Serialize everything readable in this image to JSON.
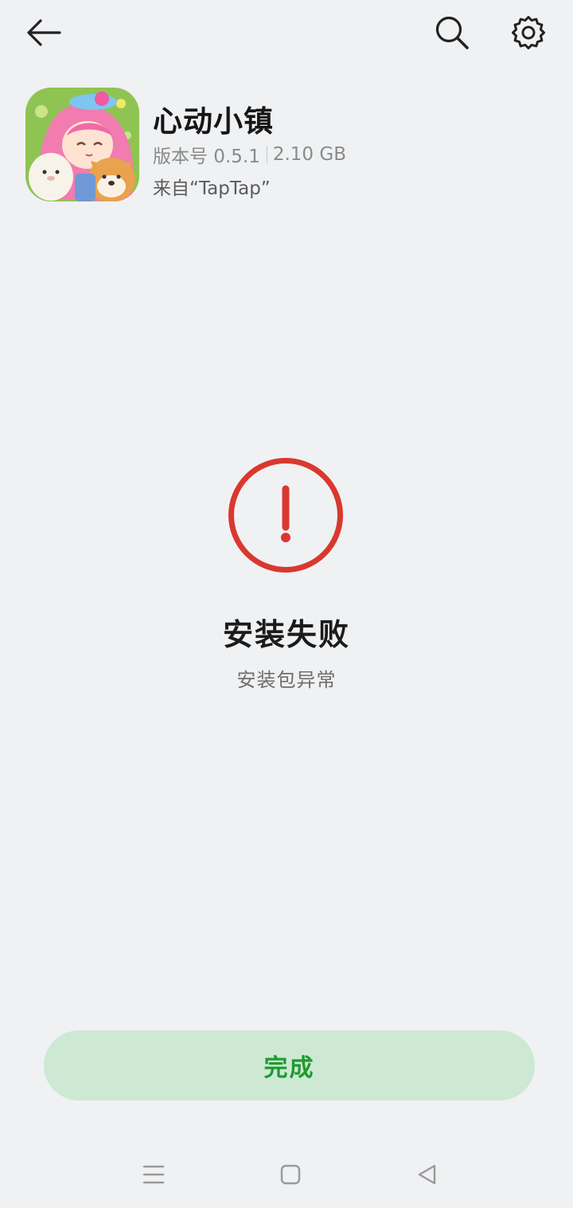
{
  "toolbar": {
    "back_icon": "arrow-left-icon",
    "search_icon": "search-icon",
    "settings_icon": "gear-icon"
  },
  "app": {
    "name": "心动小镇",
    "version_label": "版本号 0.5.1",
    "size": "2.10 GB",
    "source": "来自“TapTap”"
  },
  "status": {
    "icon": "alert-circle-icon",
    "title": "安装失败",
    "subtitle": "安装包异常",
    "color": "#d9382f"
  },
  "actions": {
    "done_label": "完成",
    "done_bg": "#cde9d4",
    "done_text_color": "#1f9a31"
  },
  "navbar": {
    "menu_icon": "menu-icon",
    "home_icon": "home-square-icon",
    "back_icon": "back-triangle-icon"
  }
}
